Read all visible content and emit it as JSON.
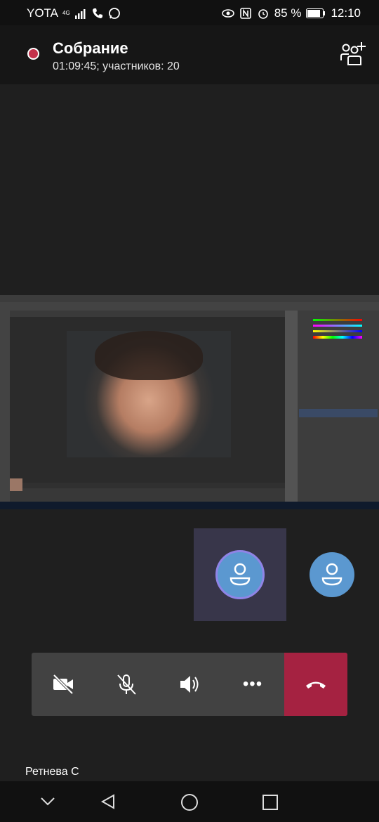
{
  "status_bar": {
    "carrier": "YOTA",
    "network": "4G",
    "battery": "85 %",
    "time": "12:10"
  },
  "meeting": {
    "title": "Собрание",
    "subtitle": "01:09:45; участников: 20"
  },
  "participant": {
    "name": "Ретнева С"
  },
  "controls": {
    "camera": "camera-off-icon",
    "mic": "mic-off-icon",
    "speaker": "speaker-icon",
    "more": "•••",
    "hangup": "hangup-icon"
  },
  "colors": {
    "record": "#c4314b",
    "hangup": "#a52241",
    "avatar": "#5b98d0",
    "active_tile": "#38364a",
    "ring": "#8f84e6"
  }
}
